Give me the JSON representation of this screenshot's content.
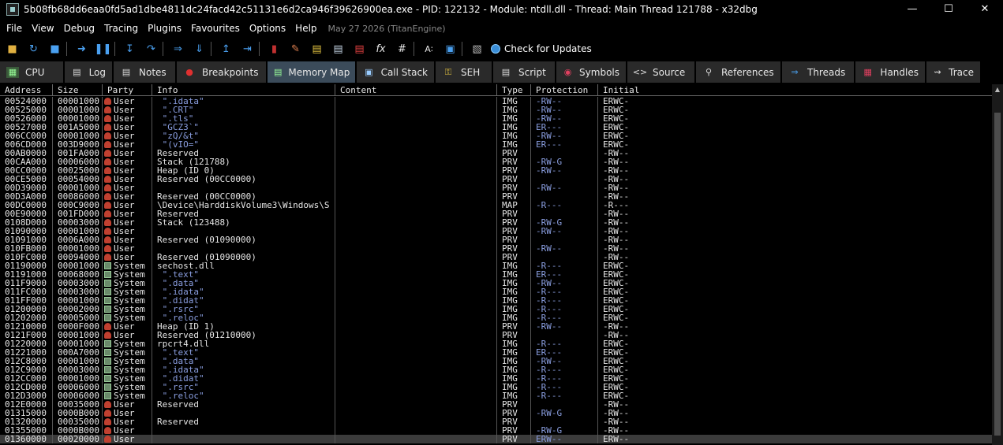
{
  "window": {
    "title": "5b08fb68dd6eaa0fd5ad1dbe4811dc24facd42c51131e6d2ca946f39626900ea.exe - PID: 122132 - Module: ntdll.dll - Thread: Main Thread 121788 - x32dbg",
    "minimize": "—",
    "maximize": "☐",
    "close": "✕"
  },
  "menu": {
    "items": [
      "File",
      "View",
      "Debug",
      "Tracing",
      "Plugins",
      "Favourites",
      "Options",
      "Help"
    ],
    "date": "May 27 2026 (TitanEngine)"
  },
  "toolbar": {
    "check_updates": "Check for Updates"
  },
  "tabs": [
    {
      "label": "CPU",
      "icon": "cpu-icon"
    },
    {
      "label": "Log",
      "icon": "log-icon"
    },
    {
      "label": "Notes",
      "icon": "notes-icon"
    },
    {
      "label": "Breakpoints",
      "icon": "breakpoint-icon"
    },
    {
      "label": "Memory Map",
      "icon": "memory-map-icon"
    },
    {
      "label": "Call Stack",
      "icon": "call-stack-icon"
    },
    {
      "label": "SEH",
      "icon": "seh-icon"
    },
    {
      "label": "Script",
      "icon": "script-icon"
    },
    {
      "label": "Symbols",
      "icon": "symbols-icon"
    },
    {
      "label": "Source",
      "icon": "source-icon"
    },
    {
      "label": "References",
      "icon": "references-icon"
    },
    {
      "label": "Threads",
      "icon": "threads-icon"
    },
    {
      "label": "Handles",
      "icon": "handles-icon"
    },
    {
      "label": "Trace",
      "icon": "trace-icon"
    }
  ],
  "columns": [
    "Address",
    "Size",
    "Party",
    "Info",
    "Content",
    "Type",
    "Protection",
    "Initial"
  ],
  "rows": [
    {
      "addr": "00524000",
      "size": "00001000",
      "party": "User",
      "info": " \".idata\"",
      "content": "",
      "type": "IMG",
      "prot": "-RW--",
      "init": "ERWC-"
    },
    {
      "addr": "00525000",
      "size": "00001000",
      "party": "User",
      "info": " \".CRT\"",
      "content": "",
      "type": "IMG",
      "prot": "-RW--",
      "init": "ERWC-"
    },
    {
      "addr": "00526000",
      "size": "00001000",
      "party": "User",
      "info": " \".tls\"",
      "content": "",
      "type": "IMG",
      "prot": "-RW--",
      "init": "ERWC-"
    },
    {
      "addr": "00527000",
      "size": "001A5000",
      "party": "User",
      "info": " \"GCZ3`\"",
      "content": "",
      "type": "IMG",
      "prot": "ER---",
      "init": "ERWC-"
    },
    {
      "addr": "006CC000",
      "size": "00001000",
      "party": "User",
      "info": " \"zQ/&t\"",
      "content": "",
      "type": "IMG",
      "prot": "-RW--",
      "init": "ERWC-"
    },
    {
      "addr": "006CD000",
      "size": "003D9000",
      "party": "User",
      "info": " \"(vIO=\"",
      "content": "",
      "type": "IMG",
      "prot": "ER---",
      "init": "ERWC-"
    },
    {
      "addr": "00AB0000",
      "size": "001FA000",
      "party": "User",
      "info": "Reserved",
      "content": "",
      "type": "PRV",
      "prot": "",
      "init": "-RW--"
    },
    {
      "addr": "00CAA000",
      "size": "00006000",
      "party": "User",
      "info": "Stack (121788)",
      "content": "",
      "type": "PRV",
      "prot": "-RW-G",
      "init": "-RW--"
    },
    {
      "addr": "00CC0000",
      "size": "00025000",
      "party": "User",
      "info": "Heap (ID 0)",
      "content": "",
      "type": "PRV",
      "prot": "-RW--",
      "init": "-RW--"
    },
    {
      "addr": "00CE5000",
      "size": "00054000",
      "party": "User",
      "info": "Reserved (00CC0000)",
      "content": "",
      "type": "PRV",
      "prot": "",
      "init": "-RW--"
    },
    {
      "addr": "00D39000",
      "size": "00001000",
      "party": "User",
      "info": "",
      "content": "",
      "type": "PRV",
      "prot": "-RW--",
      "init": "-RW--"
    },
    {
      "addr": "00D3A000",
      "size": "00086000",
      "party": "User",
      "info": "Reserved (00CC0000)",
      "content": "",
      "type": "PRV",
      "prot": "",
      "init": "-RW--"
    },
    {
      "addr": "00DC0000",
      "size": "000C9000",
      "party": "User",
      "info": "\\Device\\HarddiskVolume3\\Windows\\S",
      "content": "",
      "type": "MAP",
      "prot": "-R---",
      "init": "-R---"
    },
    {
      "addr": "00E90000",
      "size": "001FD000",
      "party": "User",
      "info": "Reserved",
      "content": "",
      "type": "PRV",
      "prot": "",
      "init": "-RW--"
    },
    {
      "addr": "0108D000",
      "size": "00003000",
      "party": "User",
      "info": "Stack (123488)",
      "content": "",
      "type": "PRV",
      "prot": "-RW-G",
      "init": "-RW--"
    },
    {
      "addr": "01090000",
      "size": "00001000",
      "party": "User",
      "info": "",
      "content": "",
      "type": "PRV",
      "prot": "-RW--",
      "init": "-RW--"
    },
    {
      "addr": "01091000",
      "size": "0006A000",
      "party": "User",
      "info": "Reserved (01090000)",
      "content": "",
      "type": "PRV",
      "prot": "",
      "init": "-RW--"
    },
    {
      "addr": "010FB000",
      "size": "00001000",
      "party": "User",
      "info": "",
      "content": "",
      "type": "PRV",
      "prot": "-RW--",
      "init": "-RW--"
    },
    {
      "addr": "010FC000",
      "size": "00094000",
      "party": "User",
      "info": "Reserved (01090000)",
      "content": "",
      "type": "PRV",
      "prot": "",
      "init": "-RW--"
    },
    {
      "addr": "01190000",
      "size": "00001000",
      "party": "System",
      "info": "sechost.dll",
      "content": "",
      "type": "IMG",
      "prot": "-R---",
      "init": "ERWC-"
    },
    {
      "addr": "01191000",
      "size": "00068000",
      "party": "System",
      "info": " \".text\"",
      "content": "",
      "type": "IMG",
      "prot": "ER---",
      "init": "ERWC-"
    },
    {
      "addr": "011F9000",
      "size": "00003000",
      "party": "System",
      "info": " \".data\"",
      "content": "",
      "type": "IMG",
      "prot": "-RW--",
      "init": "ERWC-"
    },
    {
      "addr": "011FC000",
      "size": "00003000",
      "party": "System",
      "info": " \".idata\"",
      "content": "",
      "type": "IMG",
      "prot": "-R---",
      "init": "ERWC-"
    },
    {
      "addr": "011FF000",
      "size": "00001000",
      "party": "System",
      "info": " \".didat\"",
      "content": "",
      "type": "IMG",
      "prot": "-R---",
      "init": "ERWC-"
    },
    {
      "addr": "01200000",
      "size": "00002000",
      "party": "System",
      "info": " \".rsrc\"",
      "content": "",
      "type": "IMG",
      "prot": "-R---",
      "init": "ERWC-"
    },
    {
      "addr": "01202000",
      "size": "00005000",
      "party": "System",
      "info": " \".reloc\"",
      "content": "",
      "type": "IMG",
      "prot": "-R---",
      "init": "ERWC-"
    },
    {
      "addr": "01210000",
      "size": "0000F000",
      "party": "User",
      "info": "Heap (ID 1)",
      "content": "",
      "type": "PRV",
      "prot": "-RW--",
      "init": "-RW--"
    },
    {
      "addr": "0121F000",
      "size": "00001000",
      "party": "User",
      "info": "Reserved (01210000)",
      "content": "",
      "type": "PRV",
      "prot": "",
      "init": "-RW--"
    },
    {
      "addr": "01220000",
      "size": "00001000",
      "party": "System",
      "info": "rpcrt4.dll",
      "content": "",
      "type": "IMG",
      "prot": "-R---",
      "init": "ERWC-"
    },
    {
      "addr": "01221000",
      "size": "000A7000",
      "party": "System",
      "info": " \".text\"",
      "content": "",
      "type": "IMG",
      "prot": "ER---",
      "init": "ERWC-"
    },
    {
      "addr": "012C8000",
      "size": "00001000",
      "party": "System",
      "info": " \".data\"",
      "content": "",
      "type": "IMG",
      "prot": "-RW--",
      "init": "ERWC-"
    },
    {
      "addr": "012C9000",
      "size": "00003000",
      "party": "System",
      "info": " \".idata\"",
      "content": "",
      "type": "IMG",
      "prot": "-R---",
      "init": "ERWC-"
    },
    {
      "addr": "012CC000",
      "size": "00001000",
      "party": "System",
      "info": " \".didat\"",
      "content": "",
      "type": "IMG",
      "prot": "-R---",
      "init": "ERWC-"
    },
    {
      "addr": "012CD000",
      "size": "00006000",
      "party": "System",
      "info": " \".rsrc\"",
      "content": "",
      "type": "IMG",
      "prot": "-R---",
      "init": "ERWC-"
    },
    {
      "addr": "012D3000",
      "size": "00006000",
      "party": "System",
      "info": " \".reloc\"",
      "content": "",
      "type": "IMG",
      "prot": "-R---",
      "init": "ERWC-"
    },
    {
      "addr": "012E0000",
      "size": "00035000",
      "party": "User",
      "info": "Reserved",
      "content": "",
      "type": "PRV",
      "prot": "",
      "init": "-RW--"
    },
    {
      "addr": "01315000",
      "size": "0000B000",
      "party": "User",
      "info": "",
      "content": "",
      "type": "PRV",
      "prot": "-RW-G",
      "init": "-RW--"
    },
    {
      "addr": "01320000",
      "size": "00035000",
      "party": "User",
      "info": "Reserved",
      "content": "",
      "type": "PRV",
      "prot": "",
      "init": "-RW--"
    },
    {
      "addr": "01355000",
      "size": "0000B000",
      "party": "User",
      "info": "",
      "content": "",
      "type": "PRV",
      "prot": "-RW-G",
      "init": "-RW--"
    },
    {
      "addr": "01360000",
      "size": "00020000",
      "party": "User",
      "info": "",
      "content": "",
      "type": "PRV",
      "prot": "ERW--",
      "init": "ERW--"
    }
  ],
  "selected_row": 39,
  "colors": {
    "background": "#000000",
    "tab_active": "#3b4b5a",
    "tab": "#2a2a2a",
    "protection_text": "#8a9ee0",
    "selected_row": "#3b3b3b"
  }
}
